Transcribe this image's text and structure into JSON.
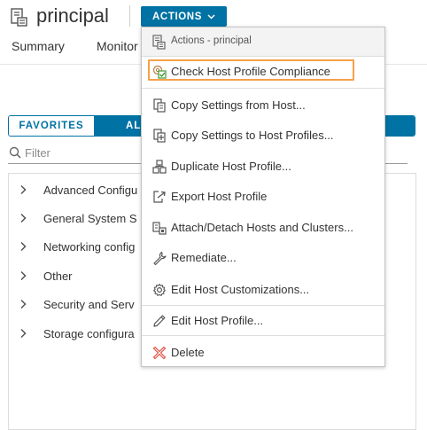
{
  "header": {
    "title": "principal",
    "actions_label": "ACTIONS"
  },
  "tabs": [
    {
      "label": "Summary"
    },
    {
      "label": "Monitor"
    }
  ],
  "toggle": {
    "favorites_label": "FAVORITES",
    "all_label": "AL"
  },
  "filter": {
    "placeholder": "Filter",
    "value": ""
  },
  "tree": {
    "items": [
      {
        "label": "Advanced Configu"
      },
      {
        "label": "General System S"
      },
      {
        "label": "Networking config"
      },
      {
        "label": "Other"
      },
      {
        "label": "Security and Serv"
      },
      {
        "label": "Storage configura"
      }
    ]
  },
  "menu": {
    "header": "Actions - principal",
    "items": [
      {
        "label": "Check Host Profile Compliance",
        "icon": "check-compliance-icon",
        "focused": true
      },
      {
        "label": "Copy Settings from Host...",
        "icon": "copy-from-host-icon"
      },
      {
        "label": "Copy Settings to Host Profiles...",
        "icon": "copy-to-profiles-icon"
      },
      {
        "label": "Duplicate Host Profile...",
        "icon": "duplicate-profile-icon"
      },
      {
        "label": "Export Host Profile",
        "icon": "export-profile-icon"
      },
      {
        "label": "Attach/Detach Hosts and Clusters...",
        "icon": "attach-detach-icon"
      },
      {
        "label": "Remediate...",
        "icon": "wrench-icon"
      },
      {
        "label": "Edit Host Customizations...",
        "icon": "gear-icon"
      },
      {
        "label": "Edit Host Profile...",
        "icon": "pencil-icon"
      },
      {
        "label": "Delete",
        "icon": "delete-x-icon"
      }
    ]
  },
  "colors": {
    "accent": "#0072a3",
    "focus_outline": "#f5a14a",
    "delete_red": "#e14f3e",
    "compliance_green": "#3f9c35"
  }
}
